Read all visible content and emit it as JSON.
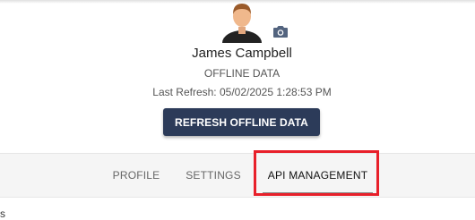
{
  "profile": {
    "name": "James Campbell",
    "offline_label": "OFFLINE DATA",
    "last_refresh_label": "Last Refresh: 05/02/2025 1:28:53 PM",
    "refresh_button_label": "REFRESH OFFLINE DATA",
    "avatar_icon": "person-avatar",
    "camera_icon": "camera-icon"
  },
  "tabs": [
    {
      "label": "PROFILE",
      "active": false
    },
    {
      "label": "SETTINGS",
      "active": false
    },
    {
      "label": "API MANAGEMENT",
      "active": true
    }
  ],
  "content": {
    "stray_text": "s"
  },
  "colors": {
    "button_bg": "#2c3b59",
    "highlight": "#e8202a",
    "tabbar_bg": "#f5f5f5"
  }
}
